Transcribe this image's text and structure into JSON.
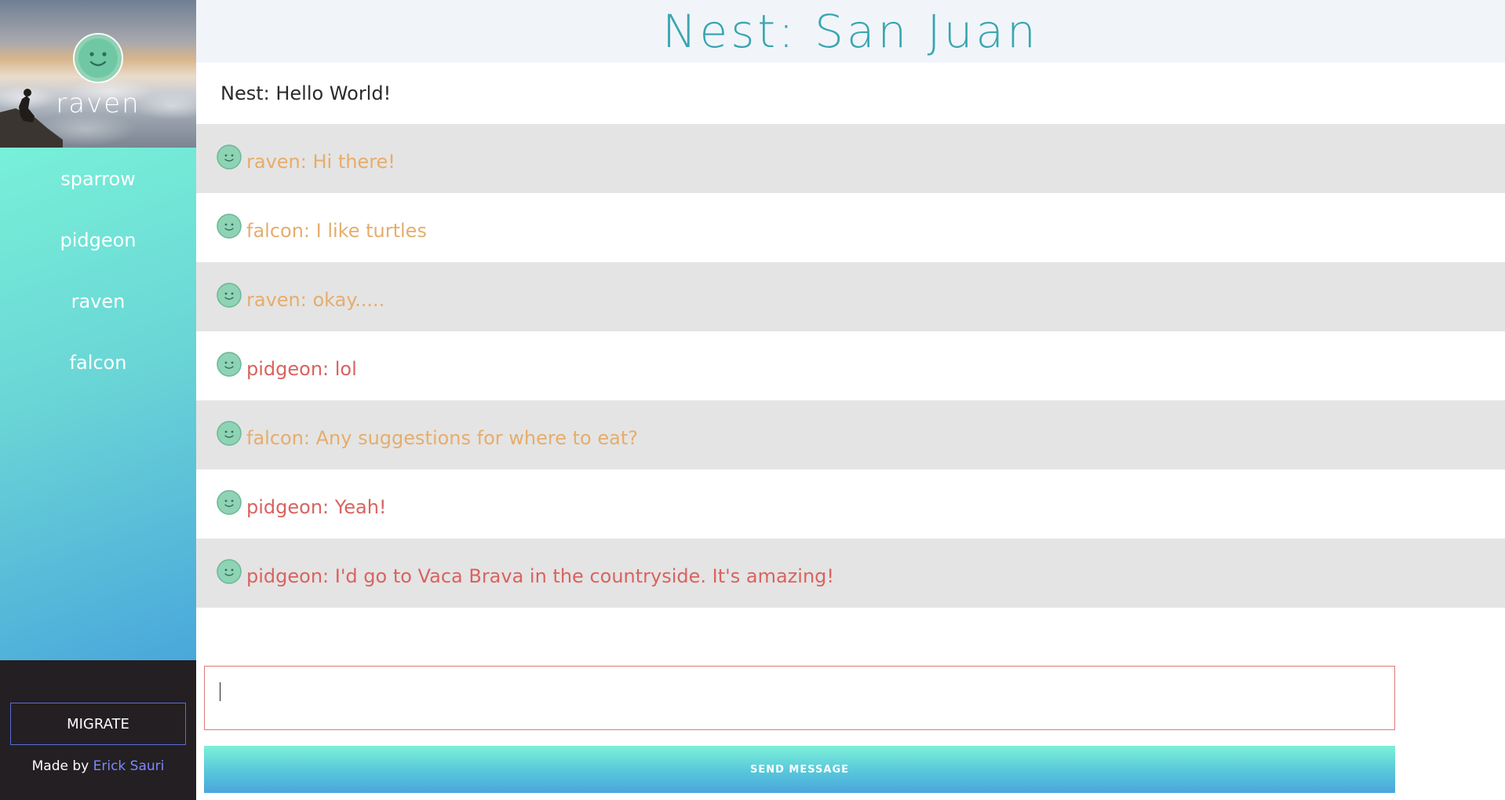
{
  "profile": {
    "name": "raven",
    "avatar_icon": "smiley-face-icon"
  },
  "nav": {
    "items": [
      {
        "label": "sparrow"
      },
      {
        "label": "pidgeon"
      },
      {
        "label": "raven"
      },
      {
        "label": "falcon"
      }
    ]
  },
  "footer": {
    "migrate_label": "MIGRATE",
    "credits_prefix": "Made by",
    "author": "Erick Sauri"
  },
  "header": {
    "title": "Nest: San Juan"
  },
  "system_message": "Nest: Hello World!",
  "messages": [
    {
      "text": "raven: Hi there!",
      "color": "#e6ad6b"
    },
    {
      "text": "falcon: I like turtles",
      "color": "#e6ad6b"
    },
    {
      "text": "raven: okay.....",
      "color": "#e6ad6b"
    },
    {
      "text": "pidgeon: lol",
      "color": "#d9635f"
    },
    {
      "text": "falcon: Any suggestions for where to eat?",
      "color": "#e6ad6b"
    },
    {
      "text": "pidgeon: Yeah!",
      "color": "#d9635f"
    },
    {
      "text": "pidgeon: I'd go to Vaca Brava in the countryside. It's amazing!",
      "color": "#d9635f"
    }
  ],
  "composer": {
    "value": "",
    "placeholder": ""
  },
  "send_label": "SEND MESSAGE",
  "colors": {
    "accent_teal": "#3aa6b0",
    "gradient_start": "#78f0d8",
    "gradient_end": "#4aa7db",
    "message_orange": "#e6ad6b",
    "message_red": "#d9635f",
    "link_blue": "#7d88ff"
  }
}
